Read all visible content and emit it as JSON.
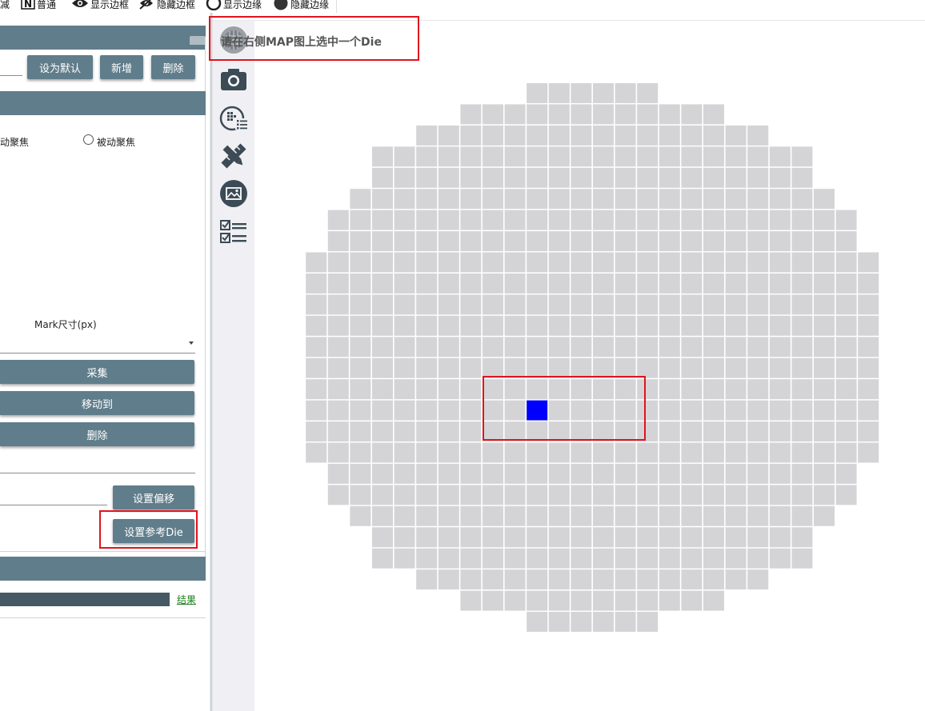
{
  "toolbar": {
    "items": [
      {
        "label": "减",
        "icon": "minus-icon"
      },
      {
        "label": "普通",
        "icon": "n-letter-icon"
      },
      {
        "label": "显示边框",
        "icon": "eye-icon"
      },
      {
        "label": "隐藏边框",
        "icon": "eye-slash-icon"
      },
      {
        "label": "显示边缘",
        "icon": "circle-outline-icon"
      },
      {
        "label": "隐藏边缘",
        "icon": "circle-filled-icon"
      }
    ]
  },
  "left_panel": {
    "buttons": {
      "set_default": "设为默认",
      "add": "新增",
      "delete_top": "删除",
      "capture": "采集",
      "move_to": "移动到",
      "delete_mid": "删除",
      "set_offset": "设置偏移",
      "set_reference_die": "设置参考Die"
    },
    "radio": {
      "active_focus": "动聚焦",
      "passive_focus": "被动聚焦"
    },
    "mark_size_label": "Mark尺寸(px)",
    "result_link": "结果"
  },
  "hint": "请在右侧MAP图上选中一个Die",
  "side_icons": [
    "wafer-map-icon",
    "camera-icon",
    "wafer-list-icon",
    "ruler-pencil-icon",
    "image-frame-icon",
    "checklist-icon"
  ],
  "colors": {
    "accent": "#607d8b",
    "die": "#d4d4d6",
    "selected_die": "#0000ff",
    "highlight": "#e0141e"
  },
  "wafer": {
    "rows": [
      {
        "span": 6
      },
      {
        "span": 12
      },
      {
        "span": 16
      },
      {
        "span": 20
      },
      {
        "span": 20
      },
      {
        "span": 22
      },
      {
        "span": 24
      },
      {
        "span": 24
      },
      {
        "span": 26
      },
      {
        "span": 26
      },
      {
        "span": 26
      },
      {
        "span": 26
      },
      {
        "span": 26
      },
      {
        "span": 26
      },
      {
        "span": 26
      },
      {
        "span": 26
      },
      {
        "span": 26
      },
      {
        "span": 26
      },
      {
        "span": 24
      },
      {
        "span": 24
      },
      {
        "span": 22
      },
      {
        "span": 20
      },
      {
        "span": 20
      },
      {
        "span": 16
      },
      {
        "span": 12
      },
      {
        "span": 6
      }
    ],
    "selected_die": {
      "row": 15,
      "col": 10
    }
  }
}
